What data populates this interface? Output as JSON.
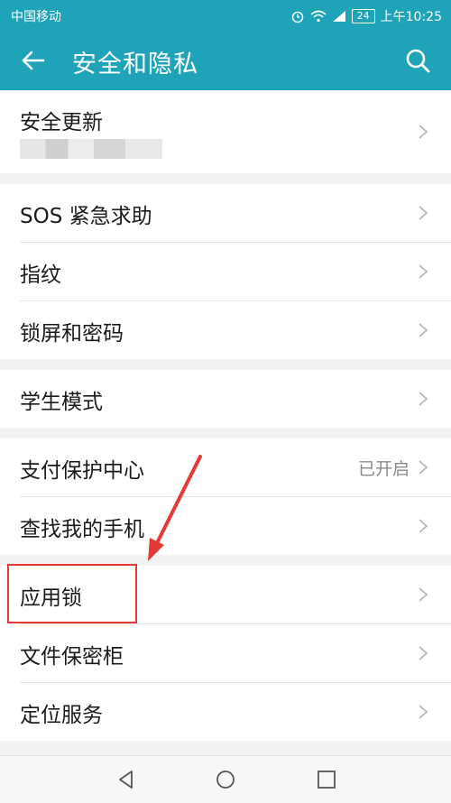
{
  "status": {
    "carrier": "中国移动",
    "battery": "24",
    "time": "上午10:25",
    "icons": [
      "alarm-icon",
      "wifi-icon",
      "signal-icon"
    ]
  },
  "appbar": {
    "title": "安全和隐私",
    "icons": [
      "back-arrow-icon",
      "search-icon"
    ]
  },
  "items": {
    "security_update": "安全更新",
    "sos": "SOS 紧急求助",
    "fingerprint": "指纹",
    "lock_screen": "锁屏和密码",
    "student_mode": "学生模式",
    "payment_protection": "支付保护中心",
    "payment_protection_status": "已开启",
    "find_my_phone": "查找我的手机",
    "app_lock": "应用锁",
    "file_safe": "文件保密柜",
    "location": "定位服务"
  },
  "colors": {
    "accent": "#1fa3b8",
    "highlight": "#e53935"
  }
}
